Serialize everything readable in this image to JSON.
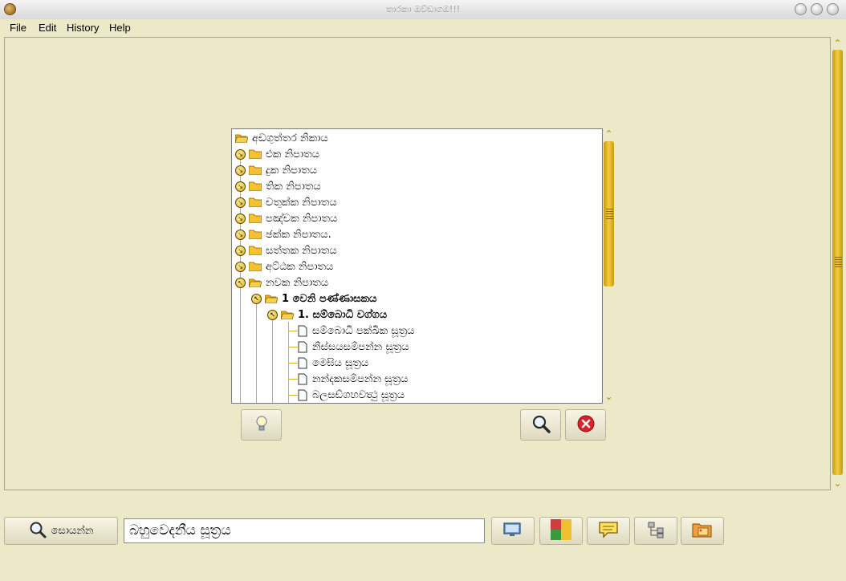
{
  "window": {
    "title": "තාරකා ඔව්ඩාගඔ!!!"
  },
  "menu": {
    "file": "File",
    "edit": "Edit",
    "history": "History",
    "help": "Help"
  },
  "tree": {
    "root": "අඩගුත්තර නිකාය",
    "items": [
      {
        "label": "එක නිපාතය"
      },
      {
        "label": "දුක නිපාතය"
      },
      {
        "label": "තික නිපාතය"
      },
      {
        "label": "චතුක්ක නිපාතය"
      },
      {
        "label": "පඤ්චක නිපාතය"
      },
      {
        "label": "ඡක්ක නිපාතය."
      },
      {
        "label": "සත්තක නිපාතය"
      },
      {
        "label": "අට්ඨක නිපාතය"
      },
      {
        "label": "නවක නිපාතය"
      },
      {
        "label": "1 වෙනි පණ්ණාසකය"
      },
      {
        "label": "1. සම්බොධි වග්ගය"
      },
      {
        "label": "සම්බොධි පක්ඛික සූත්‍රය"
      },
      {
        "label": "නිස්සයසම්පන්න සූත්‍රය"
      },
      {
        "label": "මෙඝිය සූත්‍රය"
      },
      {
        "label": "නන්දකසම්පන්න සූත්‍රය"
      },
      {
        "label": "බලසඩ්ගහවත්‍ථු සූත්‍රය"
      }
    ]
  },
  "search": {
    "button_label": "සොයන්න",
    "value": "බහුවෙදනීය සූත්‍රය"
  },
  "icons": {
    "hint": "lightbulb-icon",
    "find": "magnifier-icon",
    "close": "red-x-icon",
    "screen": "monitor-icon",
    "alphabet": "sinhala-letters-icon",
    "note": "speech-bubble-icon",
    "tree": "tree-icon",
    "folder": "folder-image-icon"
  },
  "colors": {
    "background": "#ece9c8",
    "accent": "#f3cc40",
    "close": "#d8232a"
  }
}
